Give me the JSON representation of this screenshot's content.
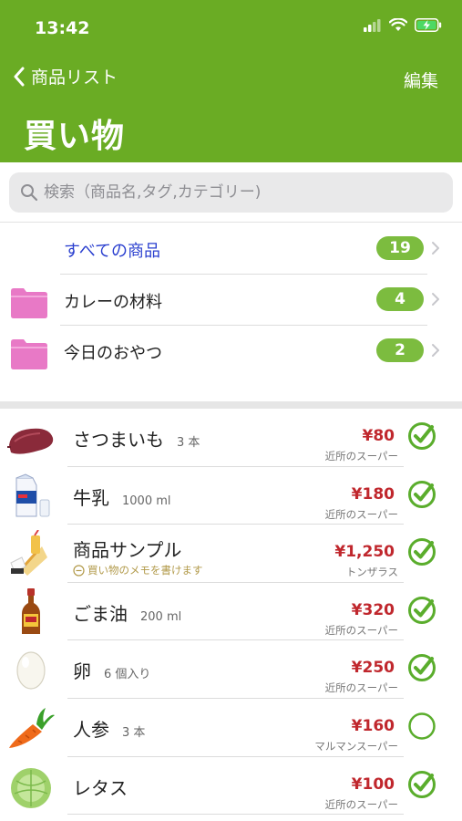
{
  "status_bar": {
    "time": "13:42",
    "icons": [
      "signal-icon",
      "wifi-icon",
      "battery-charging-icon"
    ]
  },
  "nav": {
    "back_label": "商品リスト",
    "edit_label": "編集",
    "title": "買い物"
  },
  "search": {
    "placeholder": "検索（商品名,タグ,カテゴリー)",
    "value": ""
  },
  "folders": [
    {
      "label": "すべての商品",
      "count": "19",
      "has_icon": false
    },
    {
      "label": "カレーの材料",
      "count": "4",
      "has_icon": true
    },
    {
      "label": "今日のおやつ",
      "count": "2",
      "has_icon": true
    }
  ],
  "items": [
    {
      "name": "さつまいも",
      "qty": "3 本",
      "memo": "",
      "price": "¥80",
      "store": "近所のスーパー",
      "checked": true,
      "thumb": "sweet-potato"
    },
    {
      "name": "牛乳",
      "qty": "1000 ml",
      "memo": "",
      "price": "¥180",
      "store": "近所のスーパー",
      "checked": true,
      "thumb": "milk"
    },
    {
      "name": "商品サンプル",
      "qty": "",
      "memo": "買い物のメモを書けます",
      "price": "¥1,250",
      "store": "トンザラス",
      "checked": true,
      "thumb": "sample"
    },
    {
      "name": "ごま油",
      "qty": "200 ml",
      "memo": "",
      "price": "¥320",
      "store": "近所のスーパー",
      "checked": true,
      "thumb": "sesame-oil"
    },
    {
      "name": "卵",
      "qty": "6 個入り",
      "memo": "",
      "price": "¥250",
      "store": "近所のスーパー",
      "checked": true,
      "thumb": "egg"
    },
    {
      "name": "人参",
      "qty": "3 本",
      "memo": "",
      "price": "¥160",
      "store": "マルマンスーパー",
      "checked": false,
      "thumb": "carrot"
    },
    {
      "name": "レタス",
      "qty": "",
      "memo": "",
      "price": "¥100",
      "store": "近所のスーパー",
      "checked": true,
      "thumb": "lettuce"
    }
  ],
  "colors": {
    "header_green": "#6aac24",
    "badge_green": "#7cbc3f",
    "price_red": "#c0272d",
    "folder_pink": "#e879c6",
    "all_items_blue": "#2a3fcf"
  }
}
